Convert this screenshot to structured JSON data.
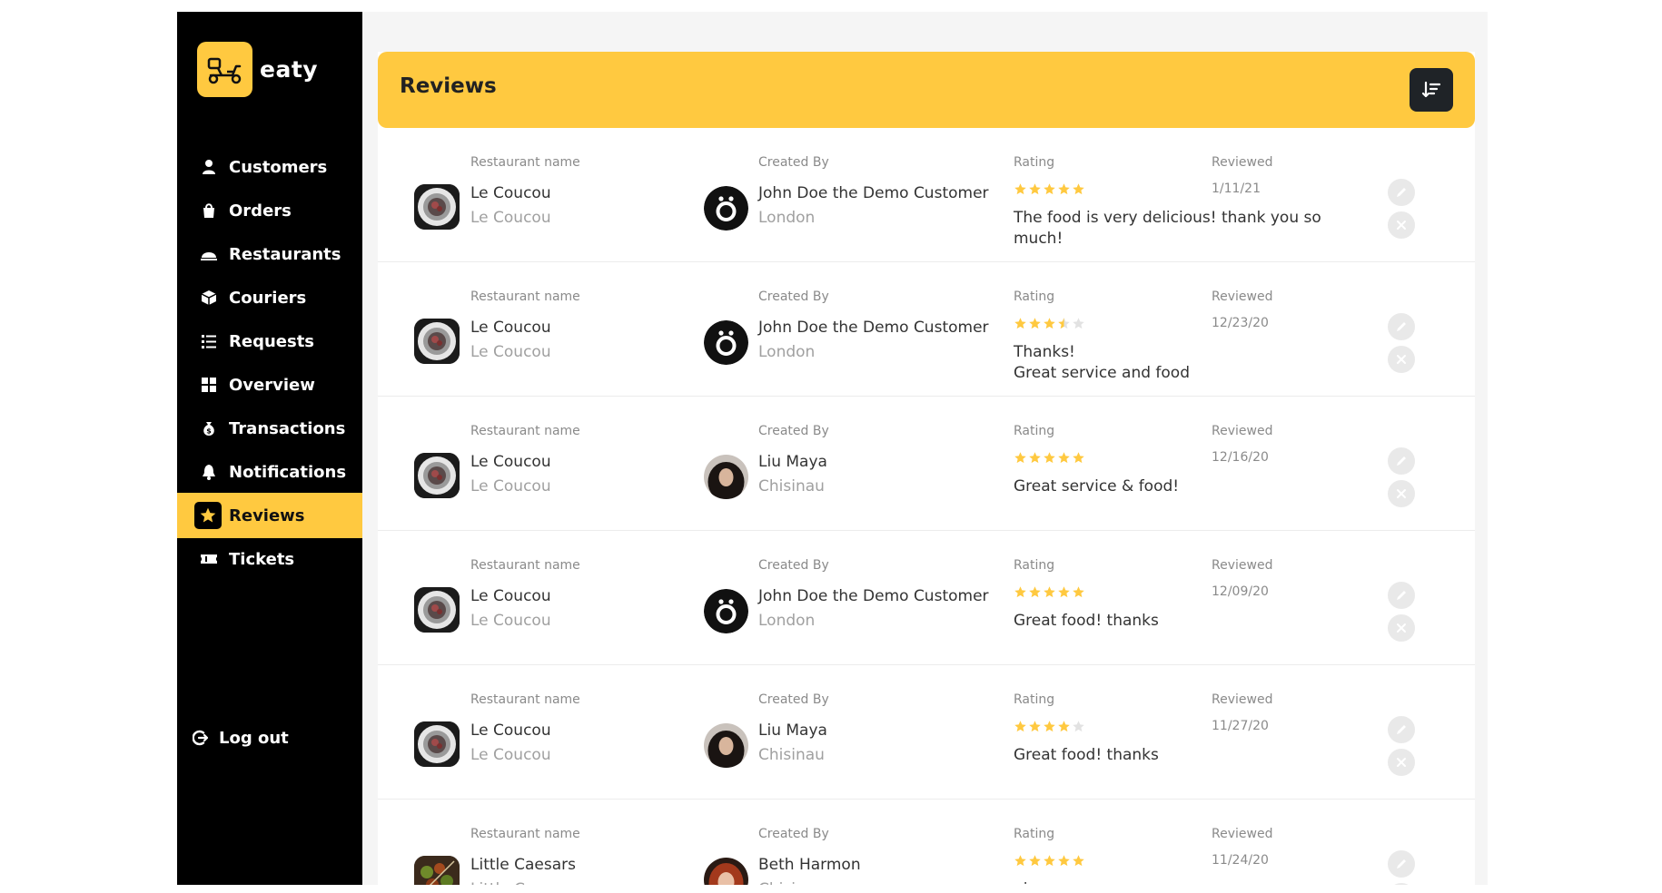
{
  "brand": {
    "name": "eaty",
    "accent": "#ffc940",
    "sidebar_bg": "#000000"
  },
  "nav": {
    "items": [
      {
        "label": "Customers",
        "icon": "user-icon"
      },
      {
        "label": "Orders",
        "icon": "bag-icon"
      },
      {
        "label": "Restaurants",
        "icon": "cloche-icon"
      },
      {
        "label": "Couriers",
        "icon": "box-icon"
      },
      {
        "label": "Requests",
        "icon": "list-icon"
      },
      {
        "label": "Overview",
        "icon": "grid-icon"
      },
      {
        "label": "Transactions",
        "icon": "money-bag-icon"
      },
      {
        "label": "Notifications",
        "icon": "bell-icon"
      },
      {
        "label": "Reviews",
        "icon": "star-icon",
        "active": true
      },
      {
        "label": "Tickets",
        "icon": "ticket-icon"
      }
    ],
    "logout": "Log out"
  },
  "page": {
    "title": "Reviews"
  },
  "columns": {
    "restaurant": "Restaurant name",
    "created_by": "Created By",
    "rating": "Rating",
    "reviewed": "Reviewed"
  },
  "reviews": [
    {
      "restaurant": "Le Coucou",
      "restaurant_sub": "Le Coucou",
      "user": "John Doe the Demo Customer",
      "city": "London",
      "avatar": "demo",
      "rating": 5,
      "comment": "The food is very delicious! thank you so much!",
      "date": "1/11/21"
    },
    {
      "restaurant": "Le Coucou",
      "restaurant_sub": "Le Coucou",
      "user": "John Doe the Demo Customer",
      "city": "London",
      "avatar": "demo",
      "rating": 3.5,
      "comment": "Thanks!\nGreat service and food",
      "date": "12/23/20"
    },
    {
      "restaurant": "Le Coucou",
      "restaurant_sub": "Le Coucou",
      "user": "Liu Maya",
      "city": "Chisinau",
      "avatar": "photo-dark",
      "rating": 5,
      "comment": "Great service & food!",
      "date": "12/16/20"
    },
    {
      "restaurant": "Le Coucou",
      "restaurant_sub": "Le Coucou",
      "user": "John Doe the Demo Customer",
      "city": "London",
      "avatar": "demo",
      "rating": 5,
      "comment": "Great food! thanks",
      "date": "12/09/20"
    },
    {
      "restaurant": "Le Coucou",
      "restaurant_sub": "Le Coucou",
      "user": "Liu Maya",
      "city": "Chisinau",
      "avatar": "photo-dark",
      "rating": 4,
      "comment": "Great food! thanks",
      "date": "11/27/20"
    },
    {
      "restaurant": "Little Caesars",
      "restaurant_sub": "Little Caesars",
      "user": "Beth Harmon",
      "city": "Chisinau",
      "avatar": "photo-red",
      "rating": 5,
      "comment": "nice one",
      "date": "11/24/20",
      "restaurant_img": "skewers"
    }
  ]
}
